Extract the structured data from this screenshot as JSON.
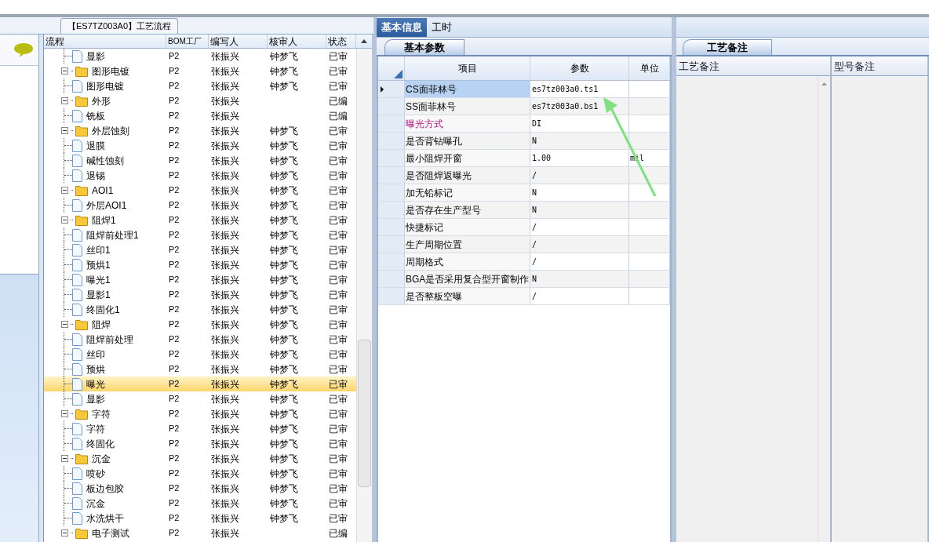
{
  "flow_panel": {
    "title": "【ES7TZ003A0】工艺流程",
    "columns": [
      "流程",
      "BOM工厂",
      "编写人",
      "核审人",
      "状态"
    ],
    "tree": [
      {
        "kind": "file",
        "name": "显影",
        "bom": "P2",
        "writer": "张振兴",
        "reviewer": "钟梦飞",
        "status": "已审",
        "selected": false
      },
      {
        "kind": "folder",
        "name": "图形电镀",
        "bom": "P2",
        "writer": "张振兴",
        "reviewer": "钟梦飞",
        "status": "已审",
        "expanded": true,
        "selected": false,
        "children": [
          {
            "kind": "file",
            "name": "图形电镀",
            "bom": "P2",
            "writer": "张振兴",
            "reviewer": "钟梦飞",
            "status": "已审",
            "selected": false
          }
        ]
      },
      {
        "kind": "folder",
        "name": "外形",
        "bom": "P2",
        "writer": "张振兴",
        "status": "已编",
        "expanded": true,
        "selected": false,
        "children": [
          {
            "kind": "file",
            "name": "铣板",
            "bom": "P2",
            "writer": "张振兴",
            "status": "已编",
            "selected": false
          }
        ]
      },
      {
        "kind": "folder",
        "name": "外层蚀刻",
        "bom": "P2",
        "writer": "张振兴",
        "reviewer": "钟梦飞",
        "status": "已审",
        "expanded": true,
        "selected": false,
        "children": [
          {
            "kind": "file",
            "name": "退膜",
            "bom": "P2",
            "writer": "张振兴",
            "reviewer": "钟梦飞",
            "status": "已审",
            "selected": false
          },
          {
            "kind": "file",
            "name": "碱性蚀刻",
            "bom": "P2",
            "writer": "张振兴",
            "reviewer": "钟梦飞",
            "status": "已审",
            "selected": false
          },
          {
            "kind": "file",
            "name": "退锡",
            "bom": "P2",
            "writer": "张振兴",
            "reviewer": "钟梦飞",
            "status": "已审",
            "selected": false
          }
        ]
      },
      {
        "kind": "folder",
        "name": "AOI1",
        "bom": "P2",
        "writer": "张振兴",
        "reviewer": "钟梦飞",
        "status": "已审",
        "expanded": true,
        "selected": false,
        "children": [
          {
            "kind": "file",
            "name": "外层AOI1",
            "bom": "P2",
            "writer": "张振兴",
            "reviewer": "钟梦飞",
            "status": "已审",
            "selected": false
          }
        ]
      },
      {
        "kind": "folder",
        "name": "阻焊1",
        "bom": "P2",
        "writer": "张振兴",
        "reviewer": "钟梦飞",
        "status": "已审",
        "expanded": true,
        "selected": false,
        "children": [
          {
            "kind": "file",
            "name": "阻焊前处理1",
            "bom": "P2",
            "writer": "张振兴",
            "reviewer": "钟梦飞",
            "status": "已审",
            "selected": false
          },
          {
            "kind": "file",
            "name": "丝印1",
            "bom": "P2",
            "writer": "张振兴",
            "reviewer": "钟梦飞",
            "status": "已审",
            "selected": false
          },
          {
            "kind": "file",
            "name": "预烘1",
            "bom": "P2",
            "writer": "张振兴",
            "reviewer": "钟梦飞",
            "status": "已审",
            "selected": false
          },
          {
            "kind": "file",
            "name": "曝光1",
            "bom": "P2",
            "writer": "张振兴",
            "reviewer": "钟梦飞",
            "status": "已审",
            "selected": false
          },
          {
            "kind": "file",
            "name": "显影1",
            "bom": "P2",
            "writer": "张振兴",
            "reviewer": "钟梦飞",
            "status": "已审",
            "selected": false
          },
          {
            "kind": "file",
            "name": "终固化1",
            "bom": "P2",
            "writer": "张振兴",
            "reviewer": "钟梦飞",
            "status": "已审",
            "selected": false
          }
        ]
      },
      {
        "kind": "folder",
        "name": "阻焊",
        "bom": "P2",
        "writer": "张振兴",
        "reviewer": "钟梦飞",
        "status": "已审",
        "expanded": true,
        "selected": false,
        "children": [
          {
            "kind": "file",
            "name": "阻焊前处理",
            "bom": "P2",
            "writer": "张振兴",
            "reviewer": "钟梦飞",
            "status": "已审",
            "selected": false
          },
          {
            "kind": "file",
            "name": "丝印",
            "bom": "P2",
            "writer": "张振兴",
            "reviewer": "钟梦飞",
            "status": "已审",
            "selected": false
          },
          {
            "kind": "file",
            "name": "预烘",
            "bom": "P2",
            "writer": "张振兴",
            "reviewer": "钟梦飞",
            "status": "已审",
            "selected": false
          },
          {
            "kind": "file",
            "name": "曝光",
            "bom": "P2",
            "writer": "张振兴",
            "reviewer": "钟梦飞",
            "status": "已审",
            "selected": true
          },
          {
            "kind": "file",
            "name": "显影",
            "bom": "P2",
            "writer": "张振兴",
            "reviewer": "钟梦飞",
            "status": "已审",
            "selected": false
          }
        ]
      },
      {
        "kind": "folder",
        "name": "字符",
        "bom": "P2",
        "writer": "张振兴",
        "reviewer": "钟梦飞",
        "status": "已审",
        "expanded": true,
        "selected": false,
        "children": [
          {
            "kind": "file",
            "name": "字符",
            "bom": "P2",
            "writer": "张振兴",
            "reviewer": "钟梦飞",
            "status": "已审",
            "selected": false
          },
          {
            "kind": "file",
            "name": "终固化",
            "bom": "P2",
            "writer": "张振兴",
            "reviewer": "钟梦飞",
            "status": "已审",
            "selected": false
          }
        ]
      },
      {
        "kind": "folder",
        "name": "沉金",
        "bom": "P2",
        "writer": "张振兴",
        "reviewer": "钟梦飞",
        "status": "已审",
        "expanded": true,
        "selected": false,
        "children": [
          {
            "kind": "file",
            "name": "喷砂",
            "bom": "P2",
            "writer": "张振兴",
            "reviewer": "钟梦飞",
            "status": "已审",
            "selected": false
          },
          {
            "kind": "file",
            "name": "板边包胶",
            "bom": "P2",
            "writer": "张振兴",
            "reviewer": "钟梦飞",
            "status": "已审",
            "selected": false
          },
          {
            "kind": "file",
            "name": "沉金",
            "bom": "P2",
            "writer": "张振兴",
            "reviewer": "钟梦飞",
            "status": "已审",
            "selected": false
          },
          {
            "kind": "file",
            "name": "水洗烘干",
            "bom": "P2",
            "writer": "张振兴",
            "reviewer": "钟梦飞",
            "status": "已审",
            "selected": false
          }
        ]
      },
      {
        "kind": "folder",
        "name": "电子测试",
        "bom": "P2",
        "writer": "张振兴",
        "status": "已编",
        "expanded": true,
        "selected": false
      }
    ]
  },
  "info_panel": {
    "tabs": [
      {
        "label": "基本信息",
        "selected": true
      },
      {
        "label": "工时",
        "selected": false
      }
    ],
    "subtab": "基本参数",
    "columns": [
      "项目",
      "参数",
      "单位"
    ],
    "rows": [
      {
        "item": "CS面菲林号",
        "value": "es7tz003a0.ts1",
        "selected": true,
        "highlighted": false
      },
      {
        "item": "SS面菲林号",
        "value": "es7tz003a0.bs1",
        "selected": false,
        "highlighted": false
      },
      {
        "item": "曝光方式",
        "value": "DI",
        "selected": false,
        "highlighted": true
      },
      {
        "item": "是否背钻曝孔",
        "value": "N",
        "selected": false,
        "highlighted": false
      },
      {
        "item": "最小阻焊开窗",
        "value": "1.00",
        "unit": "mil",
        "selected": false,
        "highlighted": false
      },
      {
        "item": "是否阻焊返曝光",
        "value": "/",
        "selected": false,
        "highlighted": false
      },
      {
        "item": "加无铅标记",
        "value": "N",
        "selected": false,
        "highlighted": false
      },
      {
        "item": "是否存在生产型号",
        "value": "N",
        "selected": false,
        "highlighted": false
      },
      {
        "item": "快捷标记",
        "value": "/",
        "selected": false,
        "highlighted": false
      },
      {
        "item": "生产周期位置",
        "value": "/",
        "selected": false,
        "highlighted": false
      },
      {
        "item": "周期格式",
        "value": "/",
        "selected": false,
        "highlighted": false
      },
      {
        "item": "BGA是否采用复合型开窗制作",
        "value": "N",
        "selected": false,
        "highlighted": false
      },
      {
        "item": "是否整板空曝",
        "value": "/",
        "selected": false,
        "highlighted": false
      }
    ]
  },
  "notes_panel": {
    "tab": "工艺备注",
    "columns": [
      "工艺备注",
      "型号备注"
    ]
  }
}
